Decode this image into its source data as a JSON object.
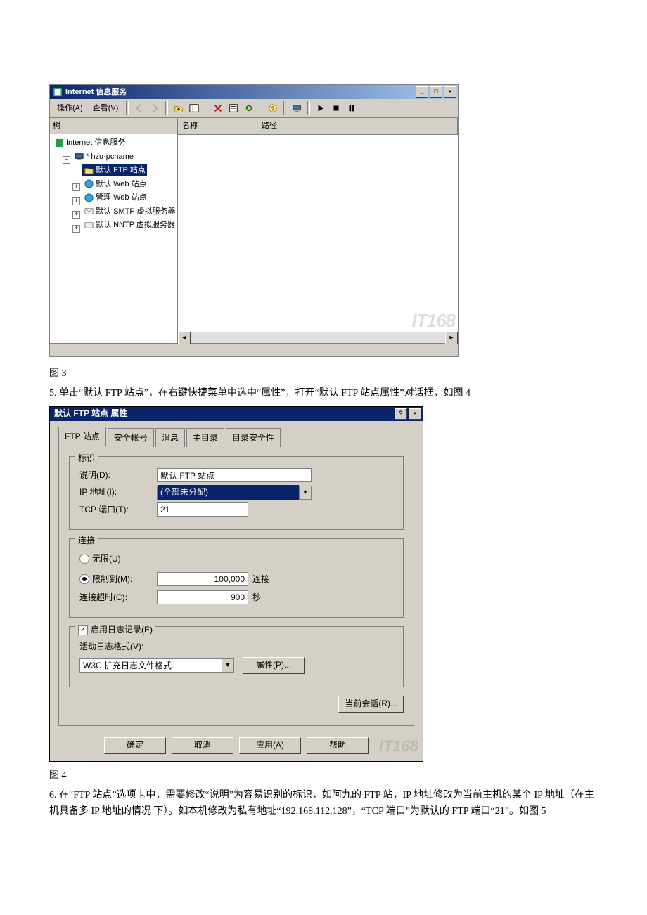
{
  "iis_window": {
    "title": "Internet 信息服务",
    "menu": {
      "action": "操作(A)",
      "view": "查看(V)"
    },
    "left_header": "树",
    "columns": {
      "name": "名称",
      "path": "路径"
    },
    "tree": {
      "root": "Internet 信息服务",
      "host": "* hzu-pcname",
      "ftp": "默认 FTP 站点",
      "web": "默认 Web 站点",
      "admin": "管理 Web 站点",
      "smtp": "默认 SMTP 虚拟服务器",
      "nntp": "默认 NNTP 虚拟服务器"
    },
    "watermark": "IT168"
  },
  "body_text": {
    "fig3": "图 3",
    "step5": "5. 单击“默认 FTP 站点”，在右键快捷菜单中选中“属性”，打开“默认 FTP 站点属性”对话框，如图 4",
    "fig4": "图 4",
    "step6": "6. 在“FTP 站点”选项卡中，需要修改“说明”为容易识别的标识，如阿九的 FTP 站，IP 地址修改为当前主机的某个 IP 地址（在主机具备多 IP 地址的情况 下）。如本机修改为私有地址“192.168.112.128”，“TCP 端口”为默认的 FTP 端口“21”。如图 5"
  },
  "dialog": {
    "title": "默认 FTP 站点 属性",
    "tabs": {
      "site": "FTP 站点",
      "security": "安全帐号",
      "message": "消息",
      "home": "主目录",
      "dirsec": "目录安全性"
    },
    "ident": {
      "legend": "标识",
      "desc_label": "说明(D):",
      "desc_value": "默认 FTP 站点",
      "ip_label": "IP 地址(I):",
      "ip_value": "(全部未分配)",
      "port_label": "TCP 端口(T):",
      "port_value": "21"
    },
    "conn": {
      "legend": "连接",
      "unlimited": "无限(U)",
      "limit": "限制到(M):",
      "limit_value": "100,000",
      "limit_unit": "连接",
      "timeout": "连接超时(C):",
      "timeout_value": "900",
      "timeout_unit": "秒"
    },
    "log": {
      "enable": "启用日志记录(E)",
      "format_label": "活动日志格式(V):",
      "format_value": "W3C 扩充日志文件格式",
      "props_btn": "属性(P)..."
    },
    "sessions_btn": "当前会话(R)...",
    "buttons": {
      "ok": "确定",
      "cancel": "取消",
      "apply": "应用(A)",
      "help": "帮助"
    },
    "watermark": "IT168"
  }
}
